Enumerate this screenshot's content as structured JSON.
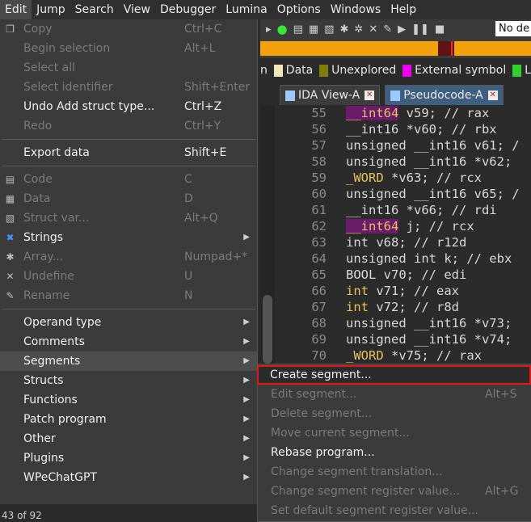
{
  "menubar": [
    "Edit",
    "Jump",
    "Search",
    "View",
    "Debugger",
    "Lumina",
    "Options",
    "Windows",
    "Help"
  ],
  "toolbar": {
    "debugger_select": "No de"
  },
  "legend": [
    {
      "label": "n",
      "color": "#3b3b3b"
    },
    {
      "label": "Data",
      "color": "#f1e6b8"
    },
    {
      "label": "Unexplored",
      "color": "#7e7e0c"
    },
    {
      "label": "External symbol",
      "color": "#ef00ef"
    },
    {
      "label": "L",
      "color": "#2fd12f"
    }
  ],
  "tabs": [
    {
      "label": "IDA View-A"
    },
    {
      "label": "Pseudocode-A"
    }
  ],
  "code": [
    {
      "ln": "55",
      "t1": "__int64",
      "t2": " v59; // rax"
    },
    {
      "ln": "56",
      "t1": "",
      "t2": "__int16 *v60; // rbx"
    },
    {
      "ln": "57",
      "t1": "",
      "t2": "unsigned __int16 v61; /"
    },
    {
      "ln": "58",
      "t1": "",
      "t2": "unsigned __int16 *v62;"
    },
    {
      "ln": "59",
      "t1": "_WORD",
      "t2": " *v63; // rcx"
    },
    {
      "ln": "60",
      "t1": "",
      "t2": "unsigned __int16 v65; /"
    },
    {
      "ln": "61",
      "t1": "",
      "t2": "__int16 *v66; // rdi"
    },
    {
      "ln": "62",
      "t1": "__int64",
      "t2": " j; // rcx"
    },
    {
      "ln": "63",
      "t1": "",
      "t2": "int v68; // r12d"
    },
    {
      "ln": "64",
      "t1": "",
      "t2": "unsigned int k; // ebx"
    },
    {
      "ln": "65",
      "t1": "",
      "t2": "BOOL v70; // edi"
    },
    {
      "ln": "66",
      "t1": "int",
      "t2": " v71; // eax"
    },
    {
      "ln": "67",
      "t1": "int",
      "t2": " v72; // r8d"
    },
    {
      "ln": "68",
      "t1": "",
      "t2": "unsigned __int16 *v73;"
    },
    {
      "ln": "69",
      "t1": "",
      "t2": "unsigned __int16 *v74;"
    },
    {
      "ln": "70",
      "t1": "_WORD",
      "t2": " *v75; // rax"
    }
  ],
  "menu": {
    "g1": [
      {
        "label": "Copy",
        "sc": "Ctrl+C",
        "dis": true,
        "icon": "copy-icon"
      },
      {
        "label": "Begin selection",
        "sc": "Alt+L",
        "dis": true
      },
      {
        "label": "Select all",
        "sc": "",
        "dis": true
      },
      {
        "label": "Select identifier",
        "sc": "Shift+Enter",
        "dis": true
      },
      {
        "label": "Undo Add struct type...",
        "sc": "Ctrl+Z",
        "dis": false
      },
      {
        "label": "Redo",
        "sc": "Ctrl+Y",
        "dis": true
      }
    ],
    "g2": [
      {
        "label": "Export data",
        "sc": "Shift+E",
        "dis": false
      }
    ],
    "g3": [
      {
        "label": "Code",
        "sc": "C",
        "dis": true,
        "icon": "code-icon"
      },
      {
        "label": "Data",
        "sc": "D",
        "dis": true,
        "icon": "data-icon"
      },
      {
        "label": "Struct var...",
        "sc": "Alt+Q",
        "dis": true,
        "icon": "struct-var-icon"
      },
      {
        "label": "Strings",
        "sc": "",
        "dis": false,
        "arrow": true,
        "icon": "strings-icon"
      },
      {
        "label": "Array...",
        "sc": "Numpad+*",
        "dis": true,
        "icon": "array-icon"
      },
      {
        "label": "Undefine",
        "sc": "U",
        "dis": true,
        "icon": "undefine-icon"
      },
      {
        "label": "Rename",
        "sc": "N",
        "dis": true,
        "icon": "rename-icon"
      }
    ],
    "g4": [
      {
        "label": "Operand type",
        "arrow": true
      },
      {
        "label": "Comments",
        "arrow": true
      },
      {
        "label": "Segments",
        "arrow": true,
        "sel": true
      },
      {
        "label": "Structs",
        "arrow": true
      },
      {
        "label": "Functions",
        "arrow": true
      },
      {
        "label": "Patch program",
        "arrow": true
      },
      {
        "label": "Other",
        "arrow": true
      },
      {
        "label": "Plugins",
        "arrow": true
      },
      {
        "label": "WPeChatGPT",
        "arrow": true
      }
    ]
  },
  "submenu": [
    {
      "label": "Create segment...",
      "sc": "",
      "dis": false,
      "hl": true
    },
    {
      "label": "Edit segment...",
      "sc": "Alt+S",
      "dis": true
    },
    {
      "label": "Delete segment...",
      "sc": "",
      "dis": true
    },
    {
      "label": "Move current segment...",
      "sc": "",
      "dis": true
    },
    {
      "label": "Rebase program...",
      "sc": "",
      "dis": false
    },
    {
      "label": "Change segment translation...",
      "sc": "",
      "dis": true
    },
    {
      "label": "Change segment register value...",
      "sc": "Alt+G",
      "dis": true
    },
    {
      "label": "Set default segment register value...",
      "sc": "",
      "dis": true
    }
  ],
  "status": "43 of 92"
}
